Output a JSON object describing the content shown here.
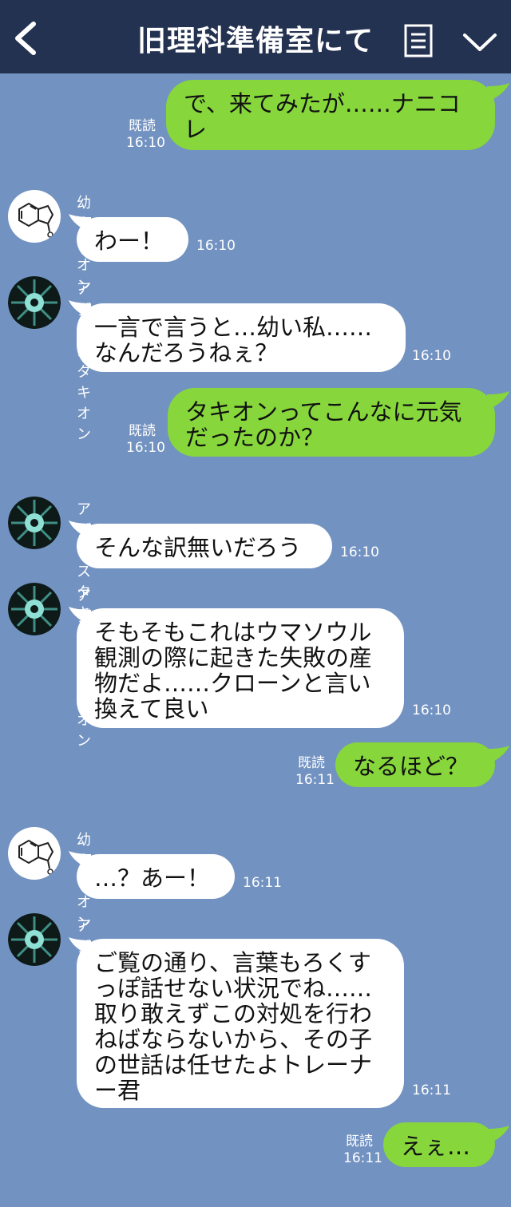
{
  "header": {
    "title": "旧理科準備室にて"
  },
  "icons": {
    "back": "back-arrow-icon",
    "menu": "menu-list-icon",
    "chevron": "chevron-down-icon"
  },
  "colors": {
    "header": "#243251",
    "background": "#7292c1",
    "outgoing": "#86d63c",
    "incoming": "#ffffff"
  },
  "messages": [
    {
      "from": "me",
      "text": "で、来てみたが……ナニコ\nレ",
      "read": "既読",
      "time": "16:10"
    },
    {
      "from": "幼タキオン",
      "text": "わー！",
      "time": "16:10"
    },
    {
      "from": "アグネスタキオン",
      "text": "一言で言うと…幼い私……\nなんだろうねぇ？",
      "time": "16:10"
    },
    {
      "from": "me",
      "text": "タキオンってこんなに元気\nだったのか？",
      "read": "既読",
      "time": "16:10"
    },
    {
      "from": "アグネスタキオン",
      "text": "そんな訳無いだろう",
      "time": "16:10"
    },
    {
      "from": "アグネスタキオン",
      "text": "そもそもこれはウマソウル\n観測の際に起きた失敗の産\n物だよ……クローンと言い\n換えて良い",
      "time": "16:10"
    },
    {
      "from": "me",
      "text": "なるほど？",
      "read": "既読",
      "time": "16:11"
    },
    {
      "from": "幼タキオン",
      "text": "…？あー！",
      "time": "16:11"
    },
    {
      "from": "アグネスタキオン",
      "text": "ご覧の通り、言葉もろくす\nっぽ話せない状況でね……\n取り敢えずこの対処を行わ\nねばならないから、その子\nの世話は任せたよトレーナ\nー君",
      "time": "16:11"
    },
    {
      "from": "me",
      "text": "えぇ…",
      "read": "既読",
      "time": "16:11"
    }
  ]
}
